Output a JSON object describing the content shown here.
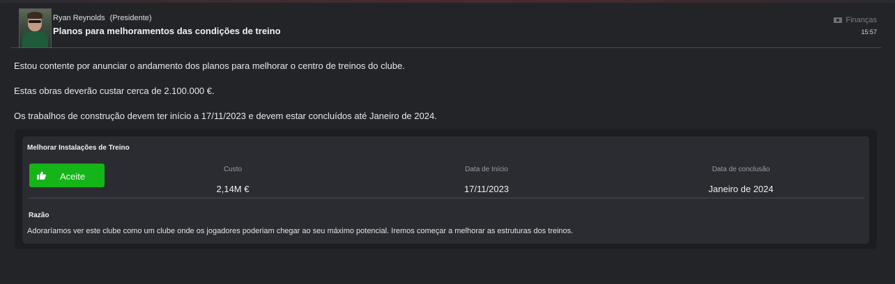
{
  "header": {
    "sender_name": "Ryan Reynolds",
    "sender_role": "(Presidente)",
    "subject": "Planos para melhoramentos das condições de treino",
    "category": "Finanças",
    "category_icon": "finance-tag-icon",
    "time": "15:57"
  },
  "message": {
    "paragraphs": [
      "Estou contente por anunciar o andamento dos planos para melhorar o centro de treinos do clube.",
      "Estas obras deverão custar cerca de 2.100.000 €.",
      "Os trabalhos de construção devem ter início a 17/11/2023 e devem estar concluídos até Janeiro de 2024."
    ]
  },
  "panel": {
    "title": "Melhorar Instalações de Treino",
    "accept_label": "Aceite",
    "accept_icon": "thumbs-up-icon",
    "accept_color": "#15b418",
    "cost_label": "Custo",
    "cost_value": "2,14M €",
    "start_label": "Data de Início",
    "start_value": "17/11/2023",
    "end_label": "Data de conclusão",
    "end_value": "Janeiro de 2024",
    "reason_title": "Razão",
    "reason_text": "Adoraríamos ver este clube como um clube onde os jogadores poderiam chegar ao seu máximo potencial. Iremos começar a melhorar as estruturas dos treinos."
  }
}
